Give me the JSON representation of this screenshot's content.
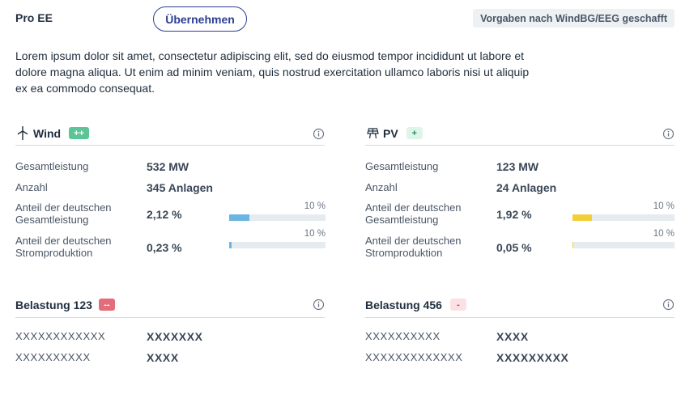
{
  "header": {
    "title": "Pro EE",
    "adopt_label": "Übernehmen",
    "status_tag": "Vorgaben nach WindBG/EEG geschafft"
  },
  "intro_text": "Lorem ipsum dolor sit amet, consectetur adipiscing elit, sed do eiusmod tempor incididunt ut labore et dolore magna aliqua. Ut enim ad minim veniam, quis nostrud exercitation ullamco laboris nisi ut aliquip ex ea commodo consequat.",
  "wind": {
    "title": "Wind",
    "badge": "++",
    "rows": [
      {
        "label": "Gesamtleistung",
        "value": "532 MW"
      },
      {
        "label": "Anzahl",
        "value": "345 Anlagen"
      }
    ],
    "shares": [
      {
        "label_1": "Anteil der deutschen",
        "label_2": "Gesamtleistung",
        "value": "2,12 %",
        "bar_pct_label": "10 %",
        "fill_percent_of_10": 21.2
      },
      {
        "label_1": "Anteil der deutschen",
        "label_2": "Stromproduktion",
        "value": "0,23 %",
        "bar_pct_label": "10 %",
        "fill_percent_of_10": 2.3
      }
    ]
  },
  "pv": {
    "title": "PV",
    "badge": "+",
    "rows": [
      {
        "label": "Gesamtleistung",
        "value": "123 MW"
      },
      {
        "label": "Anzahl",
        "value": "24 Anlagen"
      }
    ],
    "shares": [
      {
        "label_1": "Anteil der deutschen",
        "label_2": "Gesamtleistung",
        "value": "1,92 %",
        "bar_pct_label": "10 %",
        "fill_percent_of_10": 19.2
      },
      {
        "label_1": "Anteil der deutschen",
        "label_2": "Stromproduktion",
        "value": "0,05 %",
        "bar_pct_label": "10 %",
        "fill_percent_of_10": 0.5
      }
    ]
  },
  "load1": {
    "title": "Belastung 123",
    "badge": "--",
    "rows": [
      {
        "label": "XXXXXXXXXXXX",
        "value": "XXXXXXX"
      },
      {
        "label": "XXXXXXXXXX",
        "value": "XXXX"
      }
    ]
  },
  "load2": {
    "title": "Belastung 456",
    "badge": "-",
    "rows": [
      {
        "label": "XXXXXXXXXX",
        "value": "XXXX"
      },
      {
        "label": "XXXXXXXXXXXXX",
        "value": "XXXXXXXXX"
      }
    ]
  },
  "colors": {
    "wind_bar": "#6cb4e2",
    "pv_bar": "#f2cf3a",
    "badge_plusplus_bg": "#5cc598",
    "badge_plus_bg": "#dff5ea",
    "badge_minusminus_bg": "#e36d7a",
    "badge_minus_bg": "#fbe1e4",
    "accent": "#2b3e94"
  }
}
